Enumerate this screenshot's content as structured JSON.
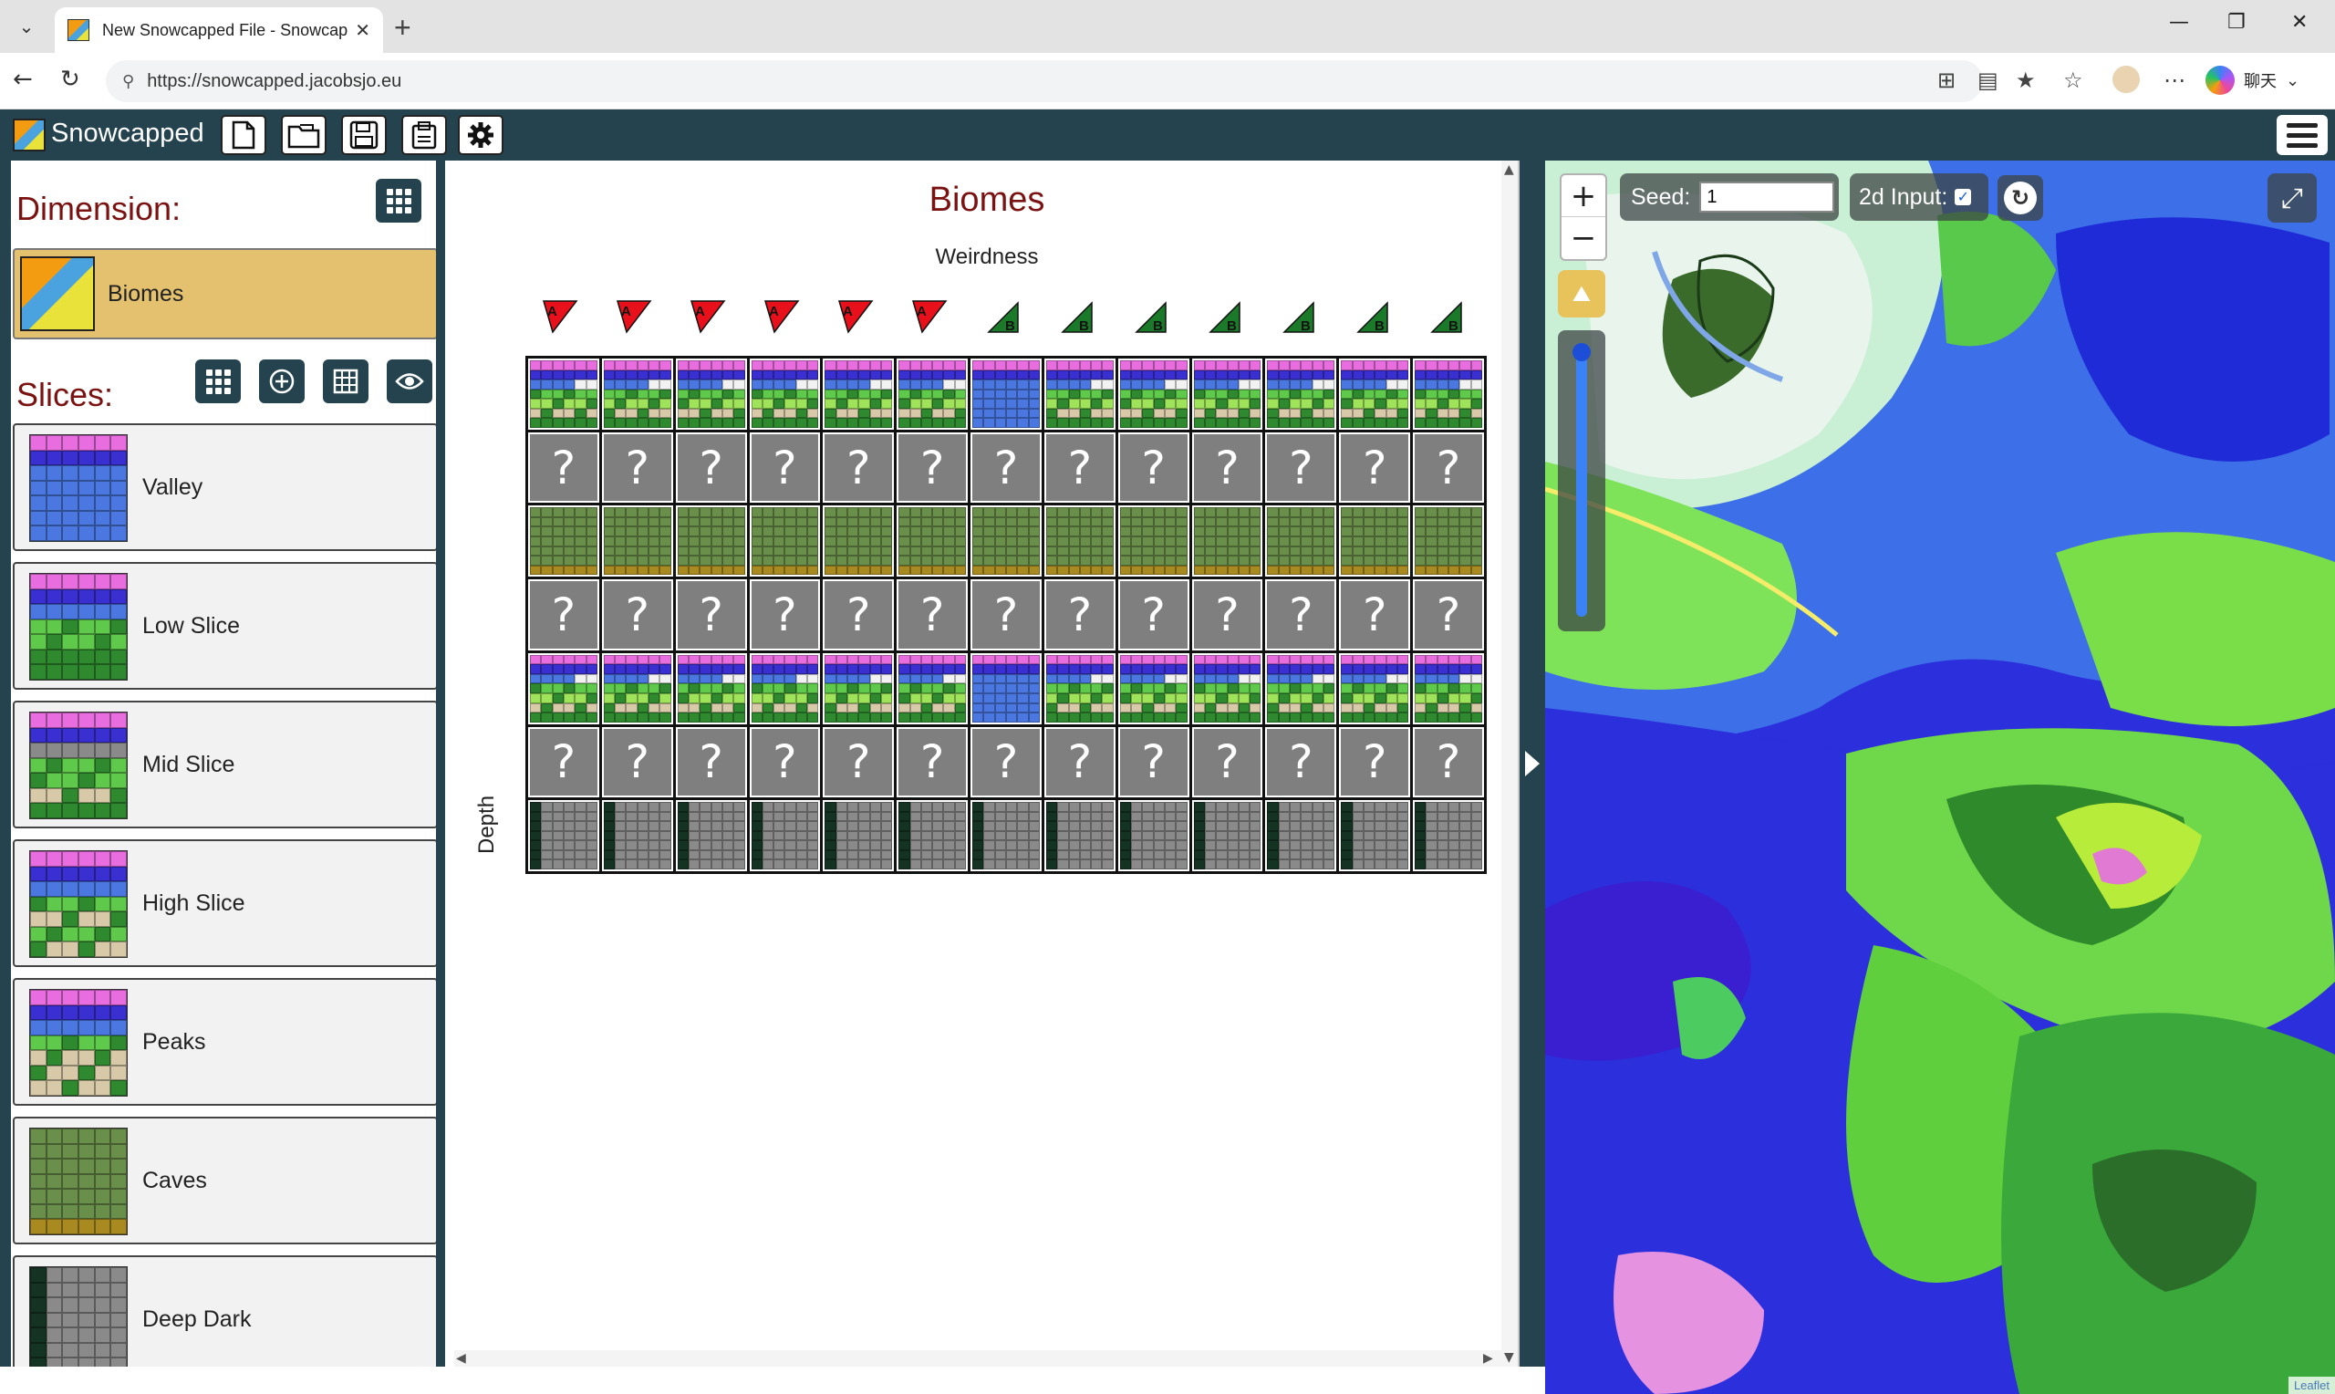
{
  "browser": {
    "tab_title": "New Snowcapped File - Snowcapp",
    "tab_close": "✕",
    "new_tab": "+",
    "url": "https://snowcapped.jacobsjo.eu",
    "copilot_label": "聊天",
    "window_controls": [
      "—",
      "❐",
      "✕"
    ]
  },
  "app": {
    "name": "Snowcapped",
    "toolbar": [
      {
        "name": "new-file-button",
        "icon": "new-file-icon"
      },
      {
        "name": "open-file-button",
        "icon": "open-folder-icon"
      },
      {
        "name": "save-button",
        "icon": "save-icon"
      },
      {
        "name": "save-as-button",
        "icon": "export-icon"
      },
      {
        "name": "settings-button",
        "icon": "gear-icon"
      }
    ]
  },
  "sidebar": {
    "dimension_title": "Dimension:",
    "dimension_item": "Biomes",
    "slices_title": "Slices:",
    "slices": [
      {
        "label": "Valley",
        "kind": "valley"
      },
      {
        "label": "Low Slice",
        "kind": "low"
      },
      {
        "label": "Mid Slice",
        "kind": "mid"
      },
      {
        "label": "High Slice",
        "kind": "high"
      },
      {
        "label": "Peaks",
        "kind": "peaks"
      },
      {
        "label": "Caves",
        "kind": "caves"
      },
      {
        "label": "Deep Dark",
        "kind": "deep"
      }
    ]
  },
  "center": {
    "title": "Biomes",
    "x_axis_label": "Weirdness",
    "y_axis_label": "Depth",
    "weirdness_flags": [
      "A",
      "A",
      "A",
      "A",
      "A",
      "A",
      "B",
      "B",
      "B",
      "B",
      "B",
      "B",
      "B"
    ],
    "rows": [
      "mixed",
      "unknown",
      "caves",
      "unknown",
      "mixed",
      "unknown",
      "deep"
    ],
    "unknown_glyph": "?"
  },
  "map": {
    "seed_label": "Seed:",
    "seed_value": "1",
    "input2d_label": "2d Input:",
    "input2d_checked": true,
    "zoom_in": "+",
    "zoom_out": "−",
    "attribution": "Leaflet"
  },
  "colors": {
    "header": "#25434f",
    "title_red": "#7b1212",
    "flag_a": "#e8101a",
    "flag_b": "#1a7a2a",
    "selected_dimension": "#e4c16e"
  }
}
